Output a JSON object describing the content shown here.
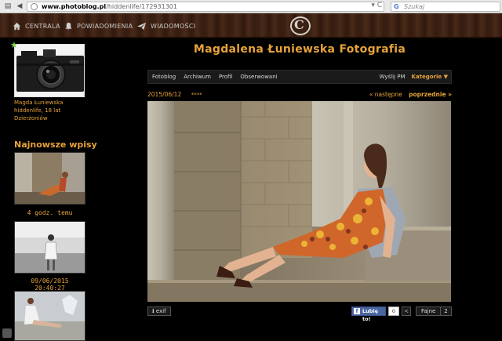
{
  "browser": {
    "url_domain": "www.photoblog.pl",
    "url_path": "/hiddenlife/172931301",
    "search_placeholder": "Szukaj",
    "search_engine_glyph": "G",
    "nav_back_glyph": "▤",
    "nav_fwd_glyph": "◀",
    "url_refresh_glyph": "▾  C",
    "search_icon_glyph": "⌕"
  },
  "topnav": {
    "items": [
      {
        "label": "CENTRALA",
        "icon": "home-icon"
      },
      {
        "label": "POWIADOMIENIA",
        "icon": "bell-icon"
      },
      {
        "label": "WIADOMOŚCI",
        "icon": "paper-plane-icon"
      }
    ],
    "logo_glyph": "C"
  },
  "profile": {
    "name": "Magda Łuniewska",
    "user_line": "hiddenlife, 18 lat",
    "city": "Dzierżoniów",
    "star_glyph": "★"
  },
  "sidebar": {
    "title": "Najnowsze wpisy",
    "entries": [
      {
        "caption": "4 godz. temu"
      },
      {
        "caption": "09/06/2015 20:40:27"
      },
      {
        "caption": ""
      }
    ]
  },
  "blog": {
    "title": "Magdalena Łuniewska Fotografia",
    "menu": [
      "Fotoblog",
      "Archiwum",
      "Profil",
      "Obserwowani"
    ],
    "send_pm": "Wyślij PM",
    "categories": "Kategorie",
    "categories_arrow": "▼"
  },
  "post": {
    "date": "2015/06/12",
    "stars": "****",
    "next": "« następne",
    "prev": "poprzednie »"
  },
  "footer": {
    "exif": "exif",
    "exif_glyph": "ℹ",
    "fb_glyph": "f",
    "fb_like": "Lubię to!",
    "fb_count": "0",
    "share_glyph": "≺",
    "fajne": "Fajne",
    "fajne_count": "2"
  },
  "colors": {
    "accent": "#e6a23a",
    "background": "#000000",
    "wood": "#3b2013",
    "facebook": "#4a66a0"
  }
}
